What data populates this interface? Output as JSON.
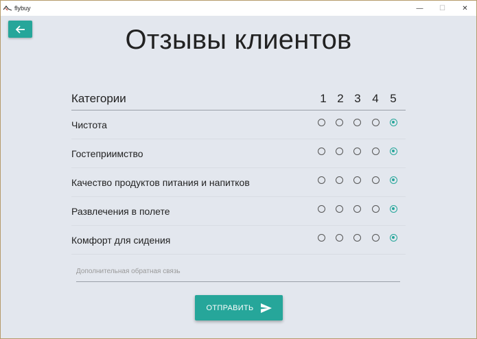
{
  "window": {
    "title": "flybuy",
    "minimize": "—",
    "maximize": "☐",
    "close": "✕"
  },
  "page": {
    "title": "Отзывы клиентов"
  },
  "table": {
    "header_label": "Категории",
    "scale": [
      "1",
      "2",
      "3",
      "4",
      "5"
    ],
    "rows": [
      {
        "label": "Чистота",
        "rating": 5
      },
      {
        "label": "Гостеприимство",
        "rating": 5
      },
      {
        "label": "Качество продуктов питания и напитков",
        "rating": 5
      },
      {
        "label": "Развлечения в полете",
        "rating": 5
      },
      {
        "label": "Комфорт для сидения",
        "rating": 5
      }
    ]
  },
  "feedback": {
    "placeholder": "Дополнительная обратная связь",
    "value": ""
  },
  "submit": {
    "label": "ОТПРАВИТЬ"
  },
  "colors": {
    "accent": "#26a69a",
    "background": "#e3e7ee"
  },
  "icons": {
    "back": "arrow-left-icon",
    "submit": "send-icon",
    "app": "flybuy-logo-icon"
  }
}
